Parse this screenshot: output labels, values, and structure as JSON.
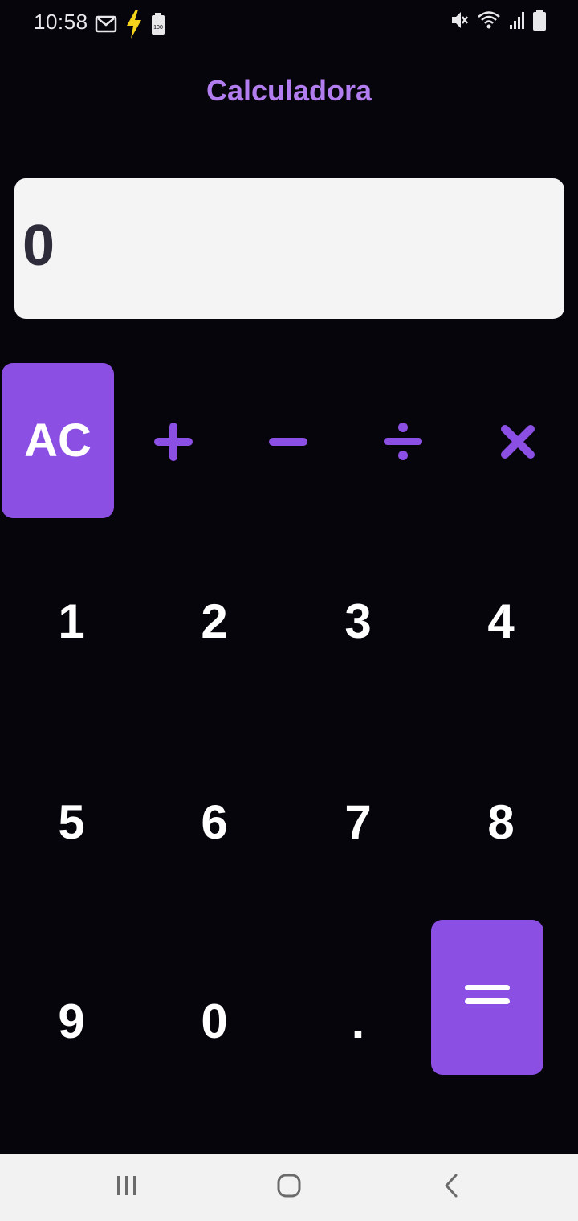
{
  "status_bar": {
    "time": "10:58",
    "left_icons": [
      "gmail-icon",
      "charging-bolt-icon",
      "battery-saver-icon"
    ],
    "right_icons": [
      "mute-icon",
      "wifi-icon",
      "signal-icon",
      "battery-icon"
    ]
  },
  "app": {
    "title": "Calculadora",
    "display_value": "0"
  },
  "buttons": {
    "clear": "AC",
    "operators": [
      "plus-icon",
      "minus-icon",
      "divide-icon",
      "multiply-icon"
    ],
    "digits": [
      "1",
      "2",
      "3",
      "4",
      "5",
      "6",
      "7",
      "8",
      "9",
      "0"
    ],
    "decimal": ".",
    "equals": "equals-icon"
  },
  "navigation": [
    "recent-apps-icon",
    "home-icon",
    "back-icon"
  ],
  "colors": {
    "background": "#06050c",
    "accent": "#8c4fe4",
    "title": "#b27dee",
    "display_bg": "#f4f4f4",
    "display_text": "#2e2b3a"
  }
}
